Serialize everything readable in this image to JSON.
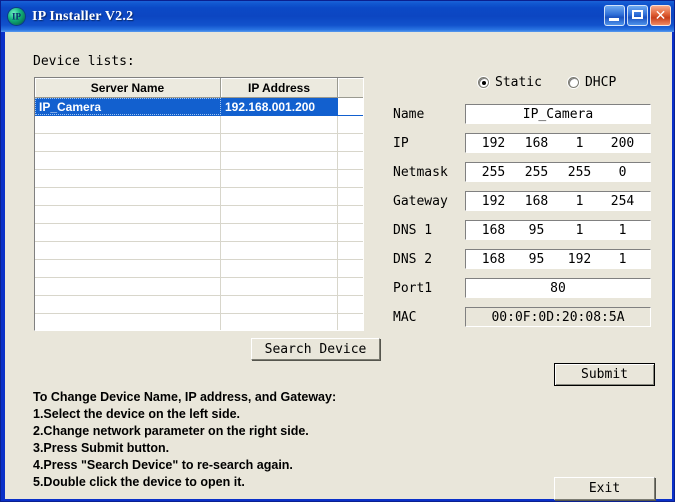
{
  "window": {
    "title": "IP Installer V2.2",
    "icon": "ip-globe-icon",
    "titlebar_color": "#0b49c6",
    "client_bg": "#e9e6da",
    "buttons": {
      "minimize": "minimize-icon",
      "maximize": "maximize-icon",
      "close": "close-icon"
    }
  },
  "device_panel": {
    "label": "Device lists:",
    "columns": [
      "Server Name",
      "IP Address",
      ""
    ],
    "rows": [
      {
        "server_name": "IP_Camera",
        "ip_address": "192.168.001.200",
        "extra": "",
        "selected": true
      },
      {
        "server_name": "",
        "ip_address": "",
        "extra": "",
        "selected": false
      },
      {
        "server_name": "",
        "ip_address": "",
        "extra": "",
        "selected": false
      },
      {
        "server_name": "",
        "ip_address": "",
        "extra": "",
        "selected": false
      },
      {
        "server_name": "",
        "ip_address": "",
        "extra": "",
        "selected": false
      },
      {
        "server_name": "",
        "ip_address": "",
        "extra": "",
        "selected": false
      },
      {
        "server_name": "",
        "ip_address": "",
        "extra": "",
        "selected": false
      },
      {
        "server_name": "",
        "ip_address": "",
        "extra": "",
        "selected": false
      },
      {
        "server_name": "",
        "ip_address": "",
        "extra": "",
        "selected": false
      },
      {
        "server_name": "",
        "ip_address": "",
        "extra": "",
        "selected": false
      },
      {
        "server_name": "",
        "ip_address": "",
        "extra": "",
        "selected": false
      },
      {
        "server_name": "",
        "ip_address": "",
        "extra": "",
        "selected": false
      },
      {
        "server_name": "",
        "ip_address": "",
        "extra": "",
        "selected": false
      }
    ],
    "selection_color": "#1260cf",
    "search_button": "Search Device"
  },
  "network_panel": {
    "mode_options": [
      {
        "label": "Static",
        "selected": true
      },
      {
        "label": "DHCP",
        "selected": false
      }
    ],
    "fields": [
      {
        "label": "Name",
        "type": "text",
        "value": "IP_Camera",
        "disabled": false
      },
      {
        "label": "IP",
        "type": "octets",
        "value": [
          "192",
          "168",
          "1",
          "200"
        ],
        "disabled": false
      },
      {
        "label": "Netmask",
        "type": "octets",
        "value": [
          "255",
          "255",
          "255",
          "0"
        ],
        "disabled": false
      },
      {
        "label": "Gateway",
        "type": "octets",
        "value": [
          "192",
          "168",
          "1",
          "254"
        ],
        "disabled": false
      },
      {
        "label": "DNS 1",
        "type": "octets",
        "value": [
          "168",
          "95",
          "1",
          "1"
        ],
        "disabled": false
      },
      {
        "label": "DNS 2",
        "type": "octets",
        "value": [
          "168",
          "95",
          "192",
          "1"
        ],
        "disabled": false
      },
      {
        "label": "Port1",
        "type": "text",
        "value": "80",
        "disabled": false
      },
      {
        "label": "MAC",
        "type": "text",
        "value": "00:0F:0D:20:08:5A",
        "disabled": true
      }
    ],
    "submit_button": "Submit",
    "exit_button": "Exit"
  },
  "instructions": [
    "To Change Device Name, IP address, and Gateway:",
    "1.Select the device on the left side.",
    "2.Change network parameter on the right side.",
    "3.Press Submit button.",
    "4.Press ʺSearch Deviceʺ  to re-search again.",
    "5.Double click the device to open it."
  ]
}
